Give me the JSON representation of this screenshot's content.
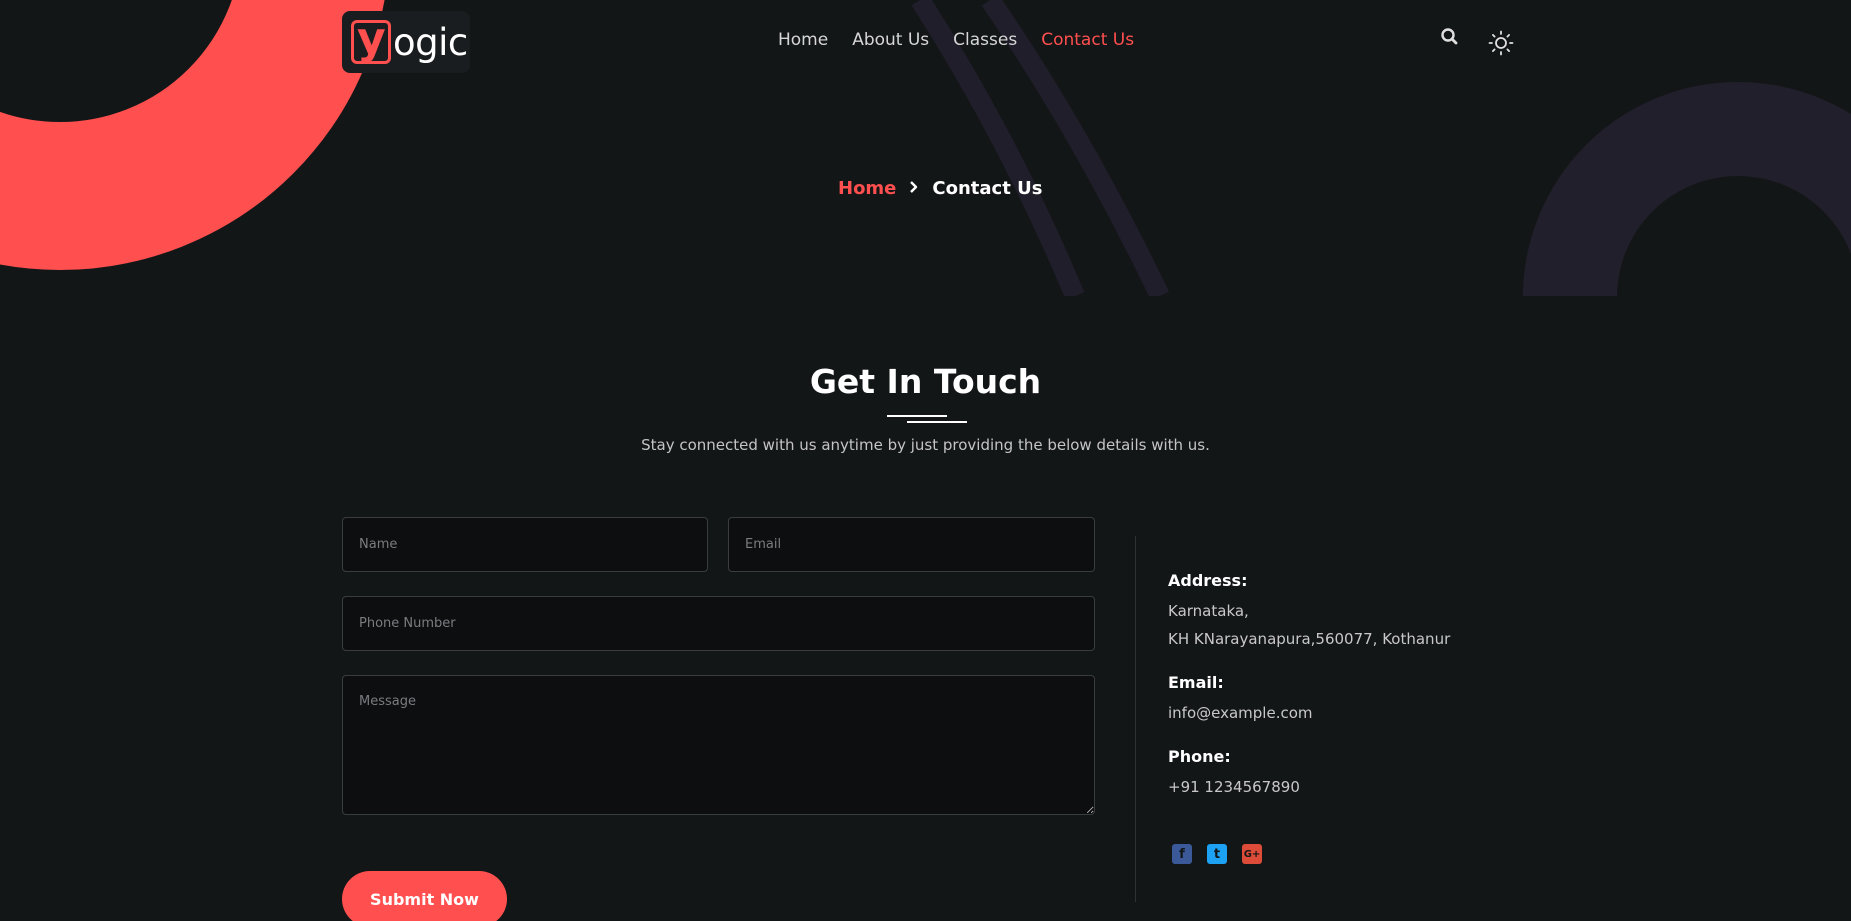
{
  "brand": {
    "logo_letter": "y",
    "logo_text": "ogic",
    "accent": "#ff4f4f"
  },
  "nav": {
    "items": [
      {
        "label": "Home"
      },
      {
        "label": "About Us"
      },
      {
        "label": "Classes"
      },
      {
        "label": "Contact Us",
        "active": true
      }
    ],
    "icons": [
      "search-icon",
      "sun-icon"
    ]
  },
  "breadcrumb": {
    "home": "Home",
    "separator_icon": "chevron-right-icon",
    "current": "Contact Us"
  },
  "section": {
    "title": "Get In Touch",
    "subtitle": "Stay connected with us anytime by just providing the below details with us."
  },
  "form": {
    "name_placeholder": "Name",
    "email_placeholder": "Email",
    "phone_placeholder": "Phone Number",
    "message_placeholder": "Message",
    "submit_label": "Submit Now"
  },
  "contact": {
    "address_label": "Address:",
    "address_line1": "Karnataka,",
    "address_line2": "KH KNarayanapura,560077, Kothanur",
    "email_label": "Email:",
    "email_value": "info@example.com",
    "phone_label": "Phone:",
    "phone_value": "+91 1234567890",
    "social": [
      {
        "icon": "facebook-icon",
        "glyph": "f",
        "color": "#3b5998"
      },
      {
        "icon": "twitter-icon",
        "glyph": "t",
        "color": "#1da1f2"
      },
      {
        "icon": "google-plus-icon",
        "glyph": "G+",
        "color": "#dd4b39"
      }
    ]
  }
}
